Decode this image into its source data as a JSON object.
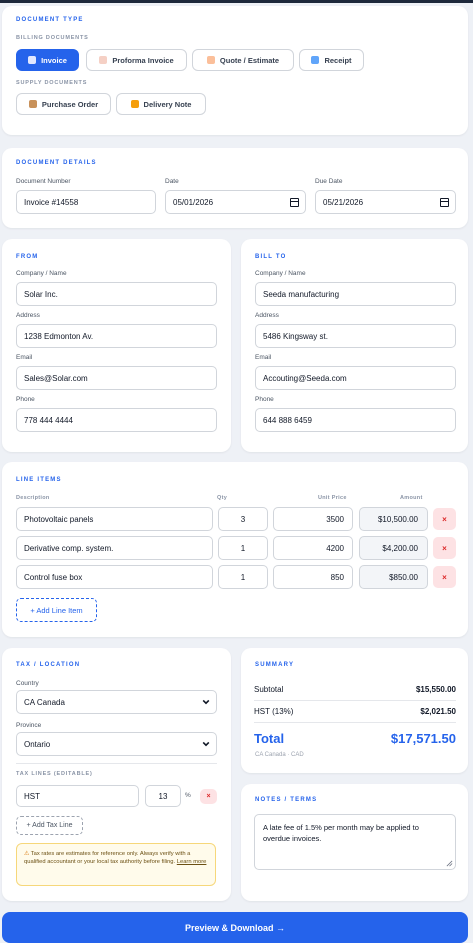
{
  "doc_type": {
    "section_title": "DOCUMENT TYPE",
    "billing_label": "BILLING DOCUMENTS",
    "billing": [
      "Invoice",
      "Proforma Invoice",
      "Quote / Estimate",
      "Receipt"
    ],
    "supply_label": "SUPPLY DOCUMENTS",
    "supply": [
      "Purchase Order",
      "Delivery Note"
    ],
    "active": "Invoice"
  },
  "details": {
    "section_title": "DOCUMENT DETAILS",
    "number_label": "Document Number",
    "number_value": "Invoice #14558",
    "date_label": "Date",
    "date_value": "05/01/2026",
    "due_label": "Due Date",
    "due_value": "05/21/2026"
  },
  "from": {
    "section_title": "FROM",
    "company_label": "Company / Name",
    "company_value": "Solar Inc.",
    "address_label": "Address",
    "address_value": "1238 Edmonton Av.",
    "email_label": "Email",
    "email_value": "Sales@Solar.com",
    "phone_label": "Phone",
    "phone_value": "778 444 4444"
  },
  "bill_to": {
    "section_title": "BILL TO",
    "company_label": "Company / Name",
    "company_value": "Seeda manufacturing",
    "address_label": "Address",
    "address_value": "5486 Kingsway st.",
    "email_label": "Email",
    "email_value": "Accouting@Seeda.com",
    "phone_label": "Phone",
    "phone_value": "644 888 6459"
  },
  "line_items": {
    "section_title": "LINE ITEMS",
    "columns": {
      "description": "Description",
      "qty": "Qty",
      "unit_price": "Unit Price",
      "amount": "Amount"
    },
    "rows": [
      {
        "description": "Photovoltaic panels",
        "qty": "3",
        "unit_price": "3500",
        "amount": "$10,500.00"
      },
      {
        "description": "Derivative comp. system.",
        "qty": "1",
        "unit_price": "4200",
        "amount": "$4,200.00"
      },
      {
        "description": "Control fuse box",
        "qty": "1",
        "unit_price": "850",
        "amount": "$850.00"
      }
    ],
    "delete_symbol": "×",
    "add_label": "+ Add Line Item"
  },
  "tax": {
    "section_title": "TAX / LOCATION",
    "country_label": "Country",
    "country_value": "CA Canada",
    "province_label": "Province",
    "province_value": "Ontario",
    "tax_lines_label": "TAX LINES (EDITABLE)",
    "tax_name": "HST",
    "tax_rate": "13",
    "percent_sign": "%",
    "add_tax_label": "+ Add Tax Line",
    "warning_text": "Tax rates are estimates for reference only. Always verify with a qualified accountant or your local tax authority before filing.",
    "learn_more": "Learn more"
  },
  "summary": {
    "section_title": "SUMMARY",
    "subtotal_label": "Subtotal",
    "subtotal_value": "$15,550.00",
    "tax_label": "HST (13%)",
    "tax_value": "$2,021.50",
    "total_label": "Total",
    "total_value": "$17,571.50",
    "currency_note": "CA Canada · CAD"
  },
  "notes": {
    "section_title": "NOTES / TERMS",
    "text": "A late fee of 1.5% per month may be applied to overdue invoices."
  },
  "cta": {
    "label": "Preview & Download →"
  },
  "colors": {
    "accent": "#2563eb",
    "danger": "#dc2626",
    "warning_bg": "#fffbeb"
  },
  "icons": [
    "invoice-icon",
    "proforma-icon",
    "quote-icon",
    "receipt-icon",
    "box-icon",
    "truck-icon",
    "calendar-icon",
    "chevron-down-icon",
    "warning-icon",
    "close-icon"
  ]
}
